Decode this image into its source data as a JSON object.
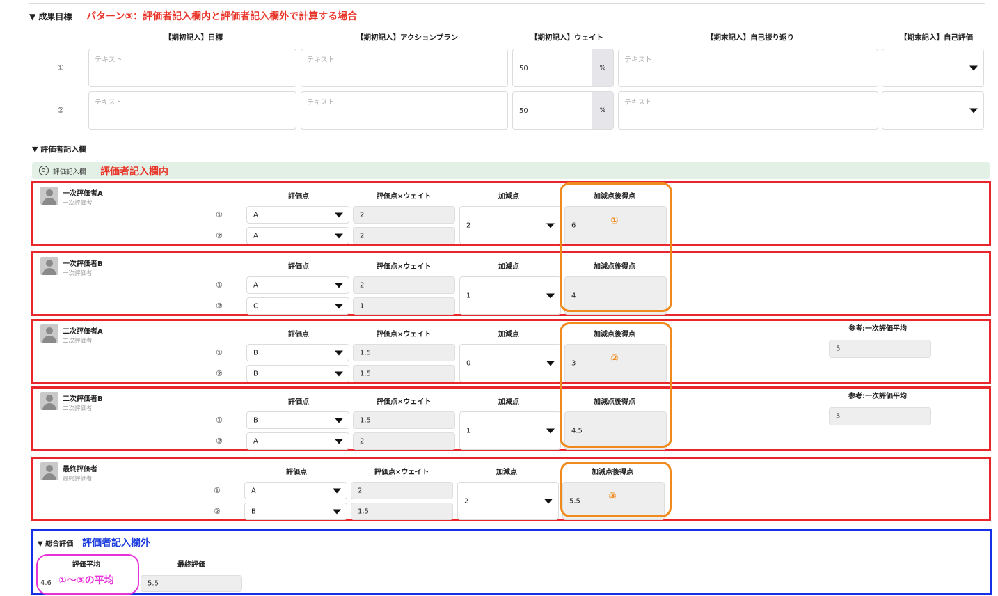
{
  "goals": {
    "section_title": "▼ 成果目標",
    "pattern_note": "パターン③：評価者記入欄内と評価者記入欄外で計算する場合",
    "columns": [
      "【期初記入】目標",
      "【期初記入】アクションプラン",
      "【期初記入】ウェイト",
      "【期末記入】自己振り返り",
      "【期末記入】自己評価"
    ],
    "placeholder": "テキスト",
    "rows": [
      {
        "label": "①",
        "weight": "50",
        "unit": "%"
      },
      {
        "label": "②",
        "weight": "50",
        "unit": "%"
      }
    ]
  },
  "evaluator_section": {
    "title": "▼ 評価者記入欄",
    "panel_title": "評価記入欄",
    "panel_note": "評価者記入欄内"
  },
  "headers": {
    "score": "評価点",
    "score_weight": "評価点×ウェイト",
    "adjust": "加減点",
    "after": "加減点後得点",
    "ref": "参考:一次評価平均"
  },
  "evaluators": [
    {
      "name": "一次評価者A",
      "role": "一次評価者",
      "rows": [
        {
          "label": "①",
          "score": "A",
          "weighted": "2"
        },
        {
          "label": "②",
          "score": "A",
          "weighted": "2"
        }
      ],
      "adjust": "2",
      "after": "6",
      "marker": "①"
    },
    {
      "name": "一次評価者B",
      "role": "一次評価者",
      "rows": [
        {
          "label": "①",
          "score": "A",
          "weighted": "2"
        },
        {
          "label": "②",
          "score": "C",
          "weighted": "1"
        }
      ],
      "adjust": "1",
      "after": "4",
      "marker": ""
    },
    {
      "name": "二次評価者A",
      "role": "二次評価者",
      "rows": [
        {
          "label": "①",
          "score": "B",
          "weighted": "1.5"
        },
        {
          "label": "②",
          "score": "B",
          "weighted": "1.5"
        }
      ],
      "adjust": "0",
      "after": "3",
      "marker": "②",
      "ref": "5"
    },
    {
      "name": "二次評価者B",
      "role": "二次評価者",
      "rows": [
        {
          "label": "①",
          "score": "B",
          "weighted": "1.5"
        },
        {
          "label": "②",
          "score": "A",
          "weighted": "2"
        }
      ],
      "adjust": "1",
      "after": "4.5",
      "marker": "",
      "ref": "5"
    },
    {
      "name": "最終評価者",
      "role": "最終評価者",
      "rows": [
        {
          "label": "①",
          "score": "A",
          "weighted": "2"
        },
        {
          "label": "②",
          "score": "B",
          "weighted": "1.5"
        }
      ],
      "adjust": "2",
      "after": "5.5",
      "marker": "③"
    }
  ],
  "summary": {
    "title": "▼ 総合評価",
    "note": "評価者記入欄外",
    "avg_label": "評価平均",
    "avg_value": "4.6",
    "avg_note": "①〜③の平均",
    "final_label": "最終評価",
    "final_value": "5.5"
  },
  "colors": {
    "red_frame": "#e8262b",
    "orange_frame": "#f08a1c",
    "blue_frame": "#1630e8",
    "magenta_frame": "#e632d8",
    "panel_bg": "#e3f0e6"
  }
}
